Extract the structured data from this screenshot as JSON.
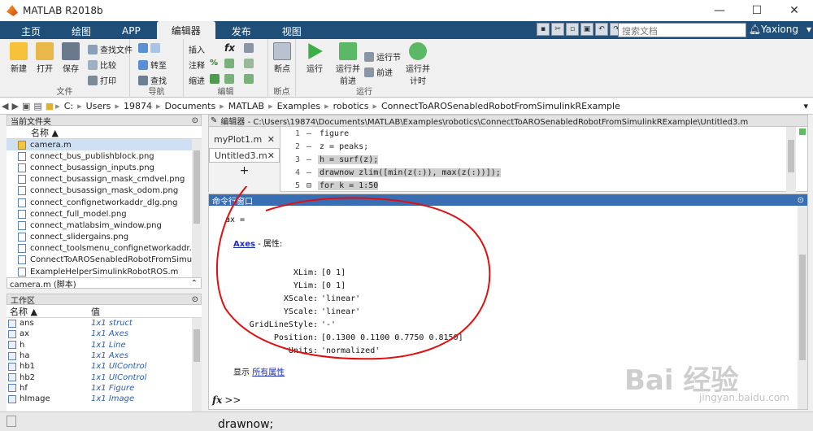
{
  "window": {
    "title": "MATLAB R2018b",
    "controls": [
      "—",
      "☐",
      "✕"
    ]
  },
  "tabs": [
    {
      "label": "主页",
      "active": false
    },
    {
      "label": "绘图",
      "active": false
    },
    {
      "label": "APP",
      "active": false
    },
    {
      "label": "编辑器",
      "active": true
    },
    {
      "label": "发布",
      "active": false
    },
    {
      "label": "视图",
      "active": false
    }
  ],
  "search": {
    "placeholder": "搜索文档"
  },
  "user": {
    "name": "Yaxiong"
  },
  "ribbon": {
    "file": {
      "group": "文件",
      "new": "新建",
      "open": "打开",
      "save": "保存",
      "find_files": "查找文件",
      "compare": "比较",
      "print": "打印"
    },
    "nav": {
      "group": "导航",
      "goto": "转至",
      "find": "查找"
    },
    "edit": {
      "group": "编辑",
      "insert": "插入",
      "comment": "注释",
      "indent": "缩进"
    },
    "bp": {
      "group": "断点",
      "breakpoints": "断点"
    },
    "run": {
      "group": "运行",
      "run": "运行",
      "run_advance": "运行并\n前进",
      "run_section": "运行节",
      "advance": "前进",
      "run_time": "运行并\n计时"
    }
  },
  "address": {
    "path": [
      "C:",
      "Users",
      "19874",
      "Documents",
      "MATLAB",
      "Examples",
      "robotics",
      "ConnectToAROSenabledRobotFromSimulinkRExample"
    ]
  },
  "current_folder": {
    "title": "当前文件夹",
    "col_name": "名称 ▲",
    "files": [
      "camera.m",
      "connect_bus_publishblock.png",
      "connect_busassign_inputs.png",
      "connect_busassign_mask_cmdvel.png",
      "connect_busassign_mask_odom.png",
      "connect_confignetworkaddr_dlg.png",
      "connect_full_model.png",
      "connect_matlabsim_window.png",
      "connect_slidergains.png",
      "connect_toolsmenu_confignetworkaddr.p...",
      "ConnectToAROSenabledRobotFromSimuli...",
      "ExampleHelperSimulinkRobotROS.m"
    ],
    "selected_index": 0
  },
  "details": {
    "label": "camera.m  (脚本)"
  },
  "workspace": {
    "title": "工作区",
    "col_name": "名称 ▲",
    "col_value": "值",
    "vars": [
      {
        "name": "ans",
        "value": "1x1 struct"
      },
      {
        "name": "ax",
        "value": "1x1 Axes"
      },
      {
        "name": "h",
        "value": "1x1 Line"
      },
      {
        "name": "ha",
        "value": "1x1 Axes"
      },
      {
        "name": "hb1",
        "value": "1x1 UIControl"
      },
      {
        "name": "hb2",
        "value": "1x1 UIControl"
      },
      {
        "name": "hf",
        "value": "1x1 Figure"
      },
      {
        "name": "hImage",
        "value": "1x1 Image"
      }
    ]
  },
  "editor": {
    "title": "编辑器 - C:\\Users\\19874\\Documents\\MATLAB\\Examples\\robotics\\ConnectToAROSenabledRobotFromSimulinkRExample\\Untitled3.m",
    "tabs": [
      {
        "label": "myPlot1.m",
        "active": false
      },
      {
        "label": "Untitled3.m",
        "active": true
      }
    ],
    "add": "+",
    "lines": [
      {
        "num": "1",
        "text": "figure",
        "hl": false
      },
      {
        "num": "2",
        "text": "z = peaks;",
        "hl": false
      },
      {
        "num": "3",
        "text": "h = surf(z);",
        "hl": true
      },
      {
        "num": "4",
        "text": "drawnow zlim([min(z(:)), max(z(:))]);",
        "hl": true
      },
      {
        "num": "5",
        "text": "for k = 1:50",
        "hl": true
      }
    ]
  },
  "command": {
    "title": "命令行窗口",
    "var": "ax =",
    "class_link": "Axes",
    "class_suffix": " - 属性:",
    "props": [
      {
        "k": "XLim:",
        "v": "[0 1]"
      },
      {
        "k": "YLim:",
        "v": "[0 1]"
      },
      {
        "k": "XScale:",
        "v": "'linear'"
      },
      {
        "k": "YScale:",
        "v": "'linear'"
      },
      {
        "k": "GridLineStyle:",
        "v": "'-'"
      },
      {
        "k": "Position:",
        "v": "[0.1300 0.1100 0.7750 0.8150]"
      },
      {
        "k": "Units:",
        "v": "'normalized'"
      }
    ],
    "show_label": "显示",
    "all_props": "所有属性",
    "fx": "fx",
    "prompt": ">>"
  },
  "bottom_text": "drawnow;",
  "watermark": {
    "brand": "Bai 经验",
    "url": "jingyan.baidu.com"
  },
  "colors": {
    "ribbon_tab": "#1f4e79",
    "cmd_header": "#3a6eb3",
    "annotation": "#e01010"
  }
}
